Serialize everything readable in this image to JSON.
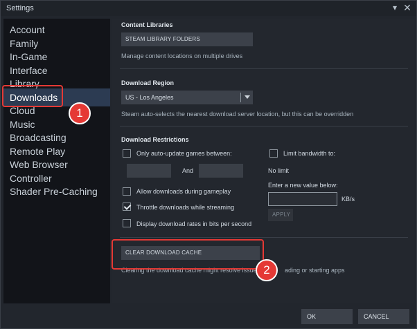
{
  "window": {
    "title": "Settings"
  },
  "sidebar": {
    "items": [
      {
        "label": "Account"
      },
      {
        "label": "Family"
      },
      {
        "label": "In-Game"
      },
      {
        "label": "Interface"
      },
      {
        "label": "Library"
      },
      {
        "label": "Downloads"
      },
      {
        "label": "Cloud"
      },
      {
        "label": "Music"
      },
      {
        "label": "Broadcasting"
      },
      {
        "label": "Remote Play"
      },
      {
        "label": "Web Browser"
      },
      {
        "label": "Controller"
      },
      {
        "label": "Shader Pre-Caching"
      }
    ],
    "active": "Downloads"
  },
  "content_libraries": {
    "title": "Content Libraries",
    "button": "STEAM LIBRARY FOLDERS",
    "description": "Manage content locations on multiple drives"
  },
  "download_region": {
    "title": "Download Region",
    "selected": "US - Los Angeles",
    "description": "Steam auto-selects the nearest download server location, but this can be overridden"
  },
  "download_restrictions": {
    "title": "Download Restrictions",
    "auto_update_label": "Only auto-update games between:",
    "auto_update_checked": false,
    "and_label": "And",
    "limit_bandwidth_label": "Limit bandwidth to:",
    "limit_bandwidth_checked": false,
    "no_limit_label": "No limit",
    "new_value_label": "Enter a new value below:",
    "unit_label": "KB/s",
    "apply_label": "APPLY",
    "allow_during_gameplay_label": "Allow downloads during gameplay",
    "allow_during_gameplay_checked": false,
    "throttle_label": "Throttle downloads while streaming",
    "throttle_checked": true,
    "bits_label": "Display download rates in bits per second",
    "bits_checked": false
  },
  "cache": {
    "button": "CLEAR DOWNLOAD CACHE",
    "description_left": "Clearing the download cache might resolve issue",
    "description_right": "ading or starting apps"
  },
  "footer": {
    "ok": "OK",
    "cancel": "CANCEL"
  },
  "annotations": {
    "badge1": "1",
    "badge2": "2",
    "color": "#e53935"
  }
}
